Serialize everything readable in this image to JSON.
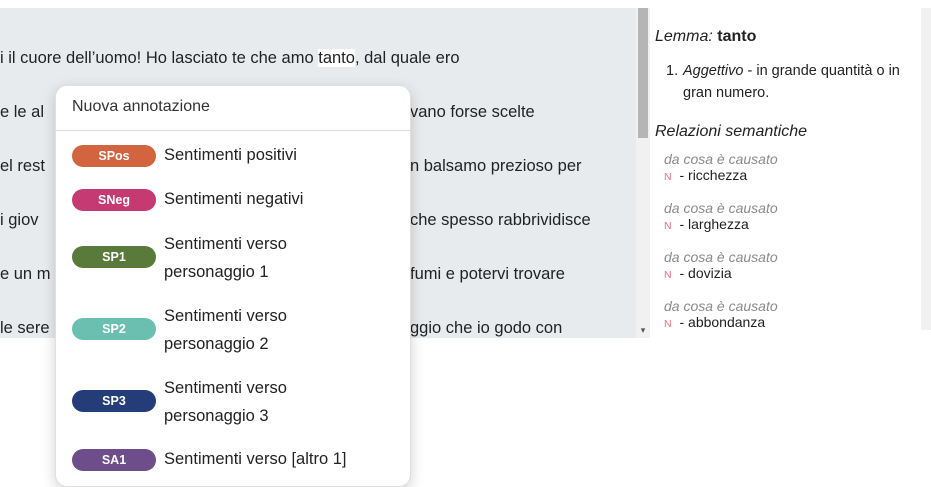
{
  "text_lines": [
    {
      "before": "i il cuore dell’uomo! Ho lasciato te che amo ",
      "highlight": "tanto",
      "after": ", dal quale ero"
    },
    {
      "before": "e le al",
      "highlight": "",
      "after": ""
    },
    {
      "before": "",
      "highlight": "",
      "after": "vano forse scelte"
    },
    {
      "before": "el rest",
      "highlight": "",
      "after": ""
    },
    {
      "before": "",
      "highlight": "",
      "after": "n balsamo prezioso per"
    },
    {
      "before": "i giov",
      "highlight": "",
      "after": ""
    },
    {
      "before": "",
      "highlight": "",
      "after": "che spesso rabbrividisce"
    },
    {
      "before": "e un m",
      "highlight": "",
      "after": ""
    },
    {
      "before": "",
      "highlight": "",
      "after": "fumi e potervi trovare"
    },
    {
      "before": "le sere",
      "highlight": "",
      "after": ""
    },
    {
      "before": "",
      "highlight": "",
      "after": "ggio che io godo con"
    }
  ],
  "scroll_down_arrow": "▾",
  "dictionary": {
    "lemma_label": "Lemma:",
    "lemma": "tanto",
    "definition_number": "1.",
    "definition_pos": "Aggettivo",
    "definition_text": " - in grande quantità o in gran numero.",
    "relations_title": "Relazioni semantiche",
    "relations": [
      {
        "type": "da cosa è causato",
        "badge": "N",
        "word": " - ricchezza"
      },
      {
        "type": "da cosa è causato",
        "badge": "N",
        "word": " - larghezza"
      },
      {
        "type": "da cosa è causato",
        "badge": "N",
        "word": " - dovizia"
      },
      {
        "type": "da cosa è causato",
        "badge": "N",
        "word": " - abbondanza"
      }
    ]
  },
  "menu": {
    "header": "Nuova annotazione",
    "items": [
      {
        "tag": "SPos",
        "label_line1": "Sentimenti positivi",
        "label_line2": "",
        "color": "#d2643f"
      },
      {
        "tag": "SNeg",
        "label_line1": "Sentimenti negativi",
        "label_line2": "",
        "color": "#c53a72"
      },
      {
        "tag": "SP1",
        "label_line1": "Sentimenti verso",
        "label_line2": "personaggio 1",
        "color": "#5a7a3b"
      },
      {
        "tag": "SP2",
        "label_line1": "Sentimenti verso",
        "label_line2": "personaggio 2",
        "color": "#6bbfb0"
      },
      {
        "tag": "SP3",
        "label_line1": "Sentimenti verso",
        "label_line2": "personaggio 3",
        "color": "#243d78"
      },
      {
        "tag": "SA1",
        "label_line1": "Sentimenti verso [altro 1]",
        "label_line2": "",
        "color": "#6d4d8a"
      }
    ]
  }
}
